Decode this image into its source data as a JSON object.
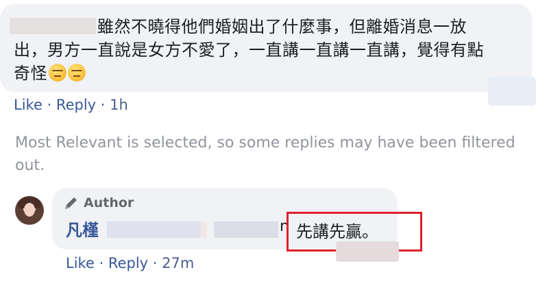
{
  "comment1": {
    "text_line1": "雖然不曉得他們婚姻出了什麼事，但離婚消息一放",
    "text_line2": "出，男方一直說是女方不愛了，一直講一直講一直講，覺得有點",
    "text_line3": "奇怪",
    "emoji_icon": "expressionless-face-icon",
    "actions": {
      "like": "Like",
      "reply": "Reply",
      "time": "1h"
    }
  },
  "filter_note": "Most Relevant is selected, so some replies may have been filtered out.",
  "reply": {
    "author_badge": "Author",
    "badge_icon": "pencil-icon",
    "name": "凡槿",
    "trailing_char": "n",
    "text": "先講先贏。",
    "actions": {
      "like": "Like",
      "reply": "Reply",
      "time": "27m"
    }
  },
  "colors": {
    "link": "#385898",
    "bubble": "#f0f2f5",
    "muted_text": "#90949c",
    "highlight_box": "#e0202a"
  }
}
